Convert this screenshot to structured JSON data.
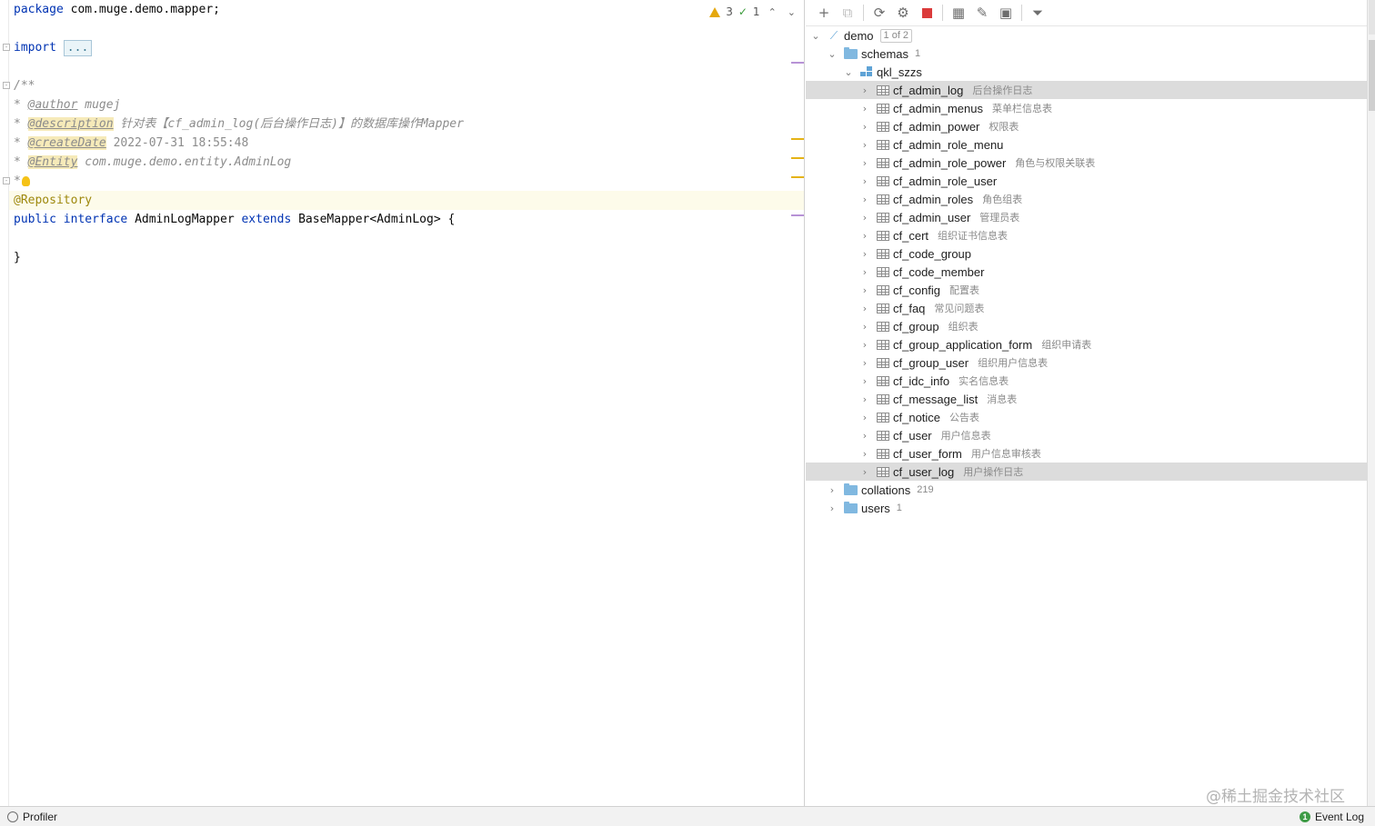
{
  "editor": {
    "inspection": {
      "warnings": "3",
      "ok": "1"
    },
    "lines": {
      "package_kw": "package",
      "package_name": " com.muge.demo.mapper;",
      "import_kw": "import",
      "import_fold": "...",
      "doc_open": "/**",
      "author_tag": "@author",
      "author_val": " mugej",
      "desc_tag": "@description",
      "desc_val": " 针对表【cf_admin_log(后台操作日志)】的数据库操作Mapper",
      "date_tag": "@createDate",
      "date_val": " 2022-07-31 18:55:48",
      "entity_tag": "@Entity",
      "entity_val": " com.muge.demo.entity.AdminLog",
      "doc_close": "*",
      "repo_anno": "@Repository",
      "public_kw": "public",
      "interface_kw": "interface",
      "class_name": " AdminLogMapper ",
      "extends_kw": "extends",
      "base_name": " BaseMapper<AdminLog> {",
      "close_brace": "}",
      "comment_prefix": "* "
    }
  },
  "db_panel": {
    "toolbar": [
      "add-icon",
      "copy-icon",
      "refresh-icon",
      "edit-settings-icon",
      "stop-icon",
      "table-view-icon",
      "edit-icon",
      "console-icon",
      "filter-icon"
    ],
    "root": {
      "label": "demo",
      "count": "1 of 2"
    },
    "schemas": {
      "label": "schemas",
      "count": "1"
    },
    "schema": {
      "label": "qkl_szzs"
    },
    "tables": [
      {
        "name": "cf_admin_log",
        "comment": "后台操作日志",
        "selected": true
      },
      {
        "name": "cf_admin_menus",
        "comment": "菜单栏信息表"
      },
      {
        "name": "cf_admin_power",
        "comment": "权限表"
      },
      {
        "name": "cf_admin_role_menu",
        "comment": ""
      },
      {
        "name": "cf_admin_role_power",
        "comment": "角色与权限关联表"
      },
      {
        "name": "cf_admin_role_user",
        "comment": ""
      },
      {
        "name": "cf_admin_roles",
        "comment": "角色组表"
      },
      {
        "name": "cf_admin_user",
        "comment": "管理员表"
      },
      {
        "name": "cf_cert",
        "comment": "组织证书信息表"
      },
      {
        "name": "cf_code_group",
        "comment": ""
      },
      {
        "name": "cf_code_member",
        "comment": ""
      },
      {
        "name": "cf_config",
        "comment": "配置表"
      },
      {
        "name": "cf_faq",
        "comment": "常见问题表"
      },
      {
        "name": "cf_group",
        "comment": "组织表"
      },
      {
        "name": "cf_group_application_form",
        "comment": "组织申请表"
      },
      {
        "name": "cf_group_user",
        "comment": "组织用户信息表"
      },
      {
        "name": "cf_idc_info",
        "comment": "实名信息表"
      },
      {
        "name": "cf_message_list",
        "comment": "消息表"
      },
      {
        "name": "cf_notice",
        "comment": "公告表"
      },
      {
        "name": "cf_user",
        "comment": "用户信息表"
      },
      {
        "name": "cf_user_form",
        "comment": "用户信息审核表"
      },
      {
        "name": "cf_user_log",
        "comment": "用户操作日志",
        "selected": true
      }
    ],
    "collations": {
      "label": "collations",
      "count": "219"
    },
    "users": {
      "label": "users",
      "count": "1"
    }
  },
  "status_bar": {
    "profiler": "Profiler",
    "event_log": "Event Log"
  },
  "watermark": "@稀土掘金技术社区",
  "colors": {
    "keyword": "#0033b3",
    "comment": "#8c8c8c",
    "annotation": "#9e880d",
    "selection": "#dcdcdc"
  }
}
